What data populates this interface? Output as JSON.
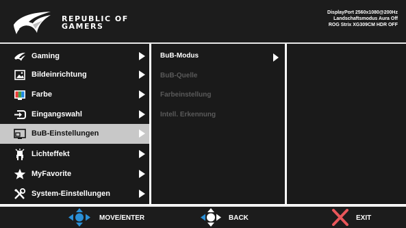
{
  "header": {
    "brand_line1": "REPUBLIC OF",
    "brand_line2": "GAMERS",
    "status_line1": "DisplayPort 2560x1080@200Hz",
    "status_line2": "Landschaftsmodus Aura Off",
    "status_line3": "ROG Strix XG309CM HDR OFF"
  },
  "menu": {
    "items": [
      {
        "label": "Gaming",
        "icon": "rog-eye-icon",
        "active": false
      },
      {
        "label": "Bildeinrichtung",
        "icon": "image-icon",
        "active": false
      },
      {
        "label": "Farbe",
        "icon": "color-icon",
        "active": false
      },
      {
        "label": "Eingangswahl",
        "icon": "input-icon",
        "active": false
      },
      {
        "label": "BuB-Einstellungen",
        "icon": "pip-icon",
        "active": true
      },
      {
        "label": "Lichteffekt",
        "icon": "light-icon",
        "active": false
      },
      {
        "label": "MyFavorite",
        "icon": "star-icon",
        "active": false
      },
      {
        "label": "System-Einstellungen",
        "icon": "wrench-icon",
        "active": false
      }
    ]
  },
  "submenu": {
    "items": [
      {
        "label": "BuB-Modus",
        "enabled": true
      },
      {
        "label": "BuB-Quelle",
        "enabled": false
      },
      {
        "label": "Farbeinstellung",
        "enabled": false
      },
      {
        "label": "Intell. Erkennung",
        "enabled": false
      }
    ]
  },
  "footer": {
    "move_label": "MOVE/ENTER",
    "back_label": "BACK",
    "exit_label": "EXIT"
  },
  "colors": {
    "panel_bg": "#1a1a1a",
    "active_bg": "#c8c8c8",
    "nav_blue": "#2a8fd6",
    "exit_red": "#e8565a"
  }
}
